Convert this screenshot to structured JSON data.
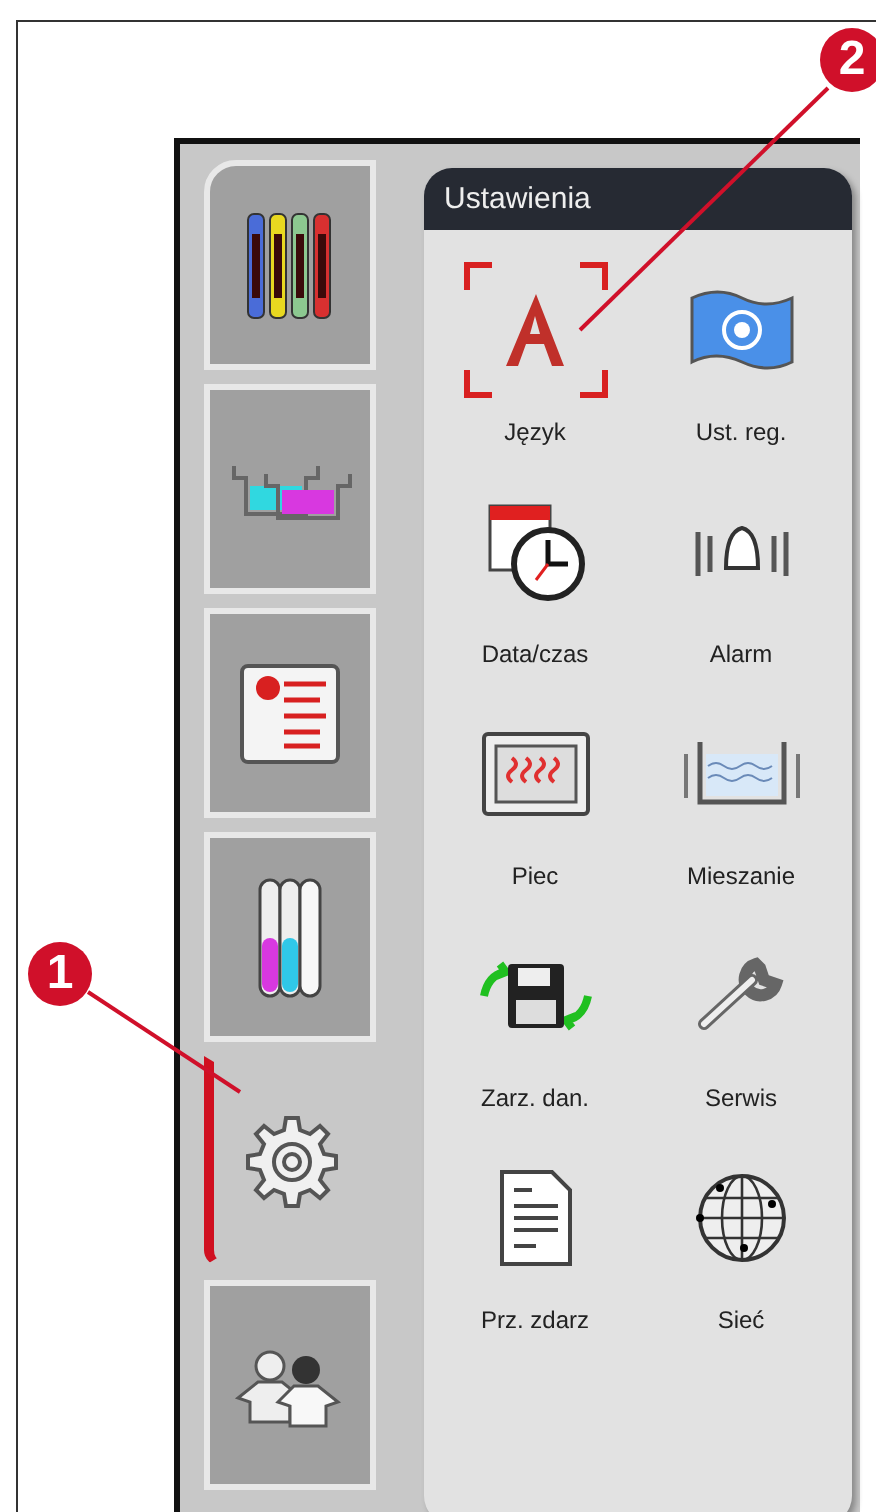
{
  "sidebar": {
    "tabs": [
      {
        "kind": "slides",
        "selected": false
      },
      {
        "kind": "baths",
        "selected": false
      },
      {
        "kind": "programs",
        "selected": false
      },
      {
        "kind": "reagents",
        "selected": false
      },
      {
        "kind": "settings",
        "selected": true
      },
      {
        "kind": "users",
        "selected": false
      }
    ]
  },
  "panel": {
    "title": "Ustawienia",
    "items": [
      {
        "kind": "language",
        "label": "Język",
        "selected": true
      },
      {
        "kind": "region",
        "label": "Ust. reg.",
        "selected": false
      },
      {
        "kind": "datetime",
        "label": "Data/czas",
        "selected": false
      },
      {
        "kind": "alarm",
        "label": "Alarm",
        "selected": false
      },
      {
        "kind": "oven",
        "label": "Piec",
        "selected": false
      },
      {
        "kind": "agitation",
        "label": "Mieszanie",
        "selected": false
      },
      {
        "kind": "data",
        "label": "Zarz. dan.",
        "selected": false
      },
      {
        "kind": "service",
        "label": "Serwis",
        "selected": false
      },
      {
        "kind": "eventlog",
        "label": "Prz. zdarz",
        "selected": false
      },
      {
        "kind": "network",
        "label": "Sieć",
        "selected": false
      }
    ]
  },
  "callouts": [
    {
      "label": "1"
    },
    {
      "label": "2"
    }
  ]
}
